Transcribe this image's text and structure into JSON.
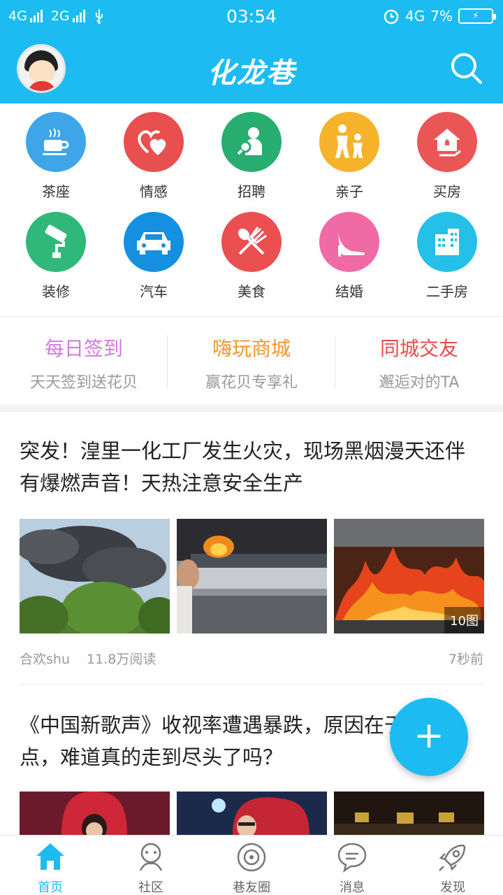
{
  "status_bar": {
    "net1": "4G",
    "net2": "2G",
    "time": "03:54",
    "net_right": "4G",
    "battery": "7%"
  },
  "header": {
    "logo_text": "化龙巷",
    "avatar_icon": "cartoon-avatar-icon",
    "search_icon": "search-icon"
  },
  "categories": [
    {
      "label": "茶座",
      "icon": "teacup-icon",
      "color": "#3ea5e8"
    },
    {
      "label": "情感",
      "icon": "hearts-icon",
      "color": "#e85050"
    },
    {
      "label": "招聘",
      "icon": "recruit-person-icon",
      "color": "#27ae70"
    },
    {
      "label": "亲子",
      "icon": "parent-child-icon",
      "color": "#f5b22a"
    },
    {
      "label": "买房",
      "icon": "house-hand-icon",
      "color": "#ea5555"
    },
    {
      "label": "装修",
      "icon": "paint-roller-icon",
      "color": "#2fb87a"
    },
    {
      "label": "汽车",
      "icon": "car-icon",
      "color": "#1590e0"
    },
    {
      "label": "美食",
      "icon": "spoon-fork-icon",
      "color": "#eb4f4f"
    },
    {
      "label": "结婚",
      "icon": "high-heel-icon",
      "color": "#f06ba6"
    },
    {
      "label": "二手房",
      "icon": "building-icon",
      "color": "#25c0e8"
    }
  ],
  "quick_links": [
    {
      "title": "每日签到",
      "subtitle": "天天签到送花贝",
      "color": "#d579e0"
    },
    {
      "title": "嗨玩商城",
      "subtitle": "赢花贝专享礼",
      "color": "#f0962e"
    },
    {
      "title": "同城交友",
      "subtitle": "邂逅对的TA",
      "color": "#ea4b4b"
    }
  ],
  "feed": [
    {
      "title": "突发！湟里一化工厂发生火灾，现场黑烟漫天还伴有爆燃声音！天热注意安全生产",
      "author": "合欢shu",
      "reads": "11.8万阅读",
      "time": "7秒前",
      "image_count": "10图"
    },
    {
      "title": "《中国新歌声》收视率遭遇暴跌，原因在于这五点，难道真的走到尽头了吗？"
    }
  ],
  "fab_label": "+",
  "bottom_nav": [
    {
      "label": "首页",
      "icon": "home-icon"
    },
    {
      "label": "社区",
      "icon": "community-icon"
    },
    {
      "label": "巷友圈",
      "icon": "friends-circle-icon"
    },
    {
      "label": "消息",
      "icon": "message-icon"
    },
    {
      "label": "发现",
      "icon": "rocket-icon"
    }
  ],
  "colors": {
    "brand": "#1cbcf3",
    "active_nav": "#1cbcf3"
  }
}
